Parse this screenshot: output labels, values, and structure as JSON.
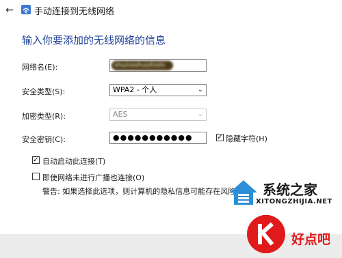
{
  "window": {
    "back_icon": "back-arrow-icon",
    "network_icon": "wifi-network-icon",
    "title": "手动连接到无线网络"
  },
  "form": {
    "heading": "输入你要添加的无线网络的信息",
    "ssid": {
      "label": "网络名(E):",
      "value": "shuinoshuizhishi"
    },
    "security_type": {
      "label": "安全类型(S):",
      "value": "WPA2 - 个人"
    },
    "encryption_type": {
      "label": "加密类型(R):",
      "value": "AES",
      "disabled": true
    },
    "security_key": {
      "label": "安全密钥(C):",
      "value": "●●●●●●●●●●●"
    },
    "hide_chars": {
      "label": "隐藏字符(H)",
      "checked": true
    },
    "auto_connect": {
      "label": "自动启动此连接(T)",
      "checked": true
    },
    "connect_hidden": {
      "label": "即使网络未进行广播也连接(O)",
      "checked": false
    },
    "warning": "警告: 如果选择此选项，则计算机的隐私信息可能存在风险。"
  },
  "watermarks": {
    "site1_cn": "系统之家",
    "site1_en": "XITONGZHIJIA.NET",
    "site2_cn": "好点吧"
  },
  "colors": {
    "heading": "#1c3f96",
    "footer": "#ececec",
    "brand_blue": "#2a8fd8",
    "brand_red": "#e01a1a"
  }
}
